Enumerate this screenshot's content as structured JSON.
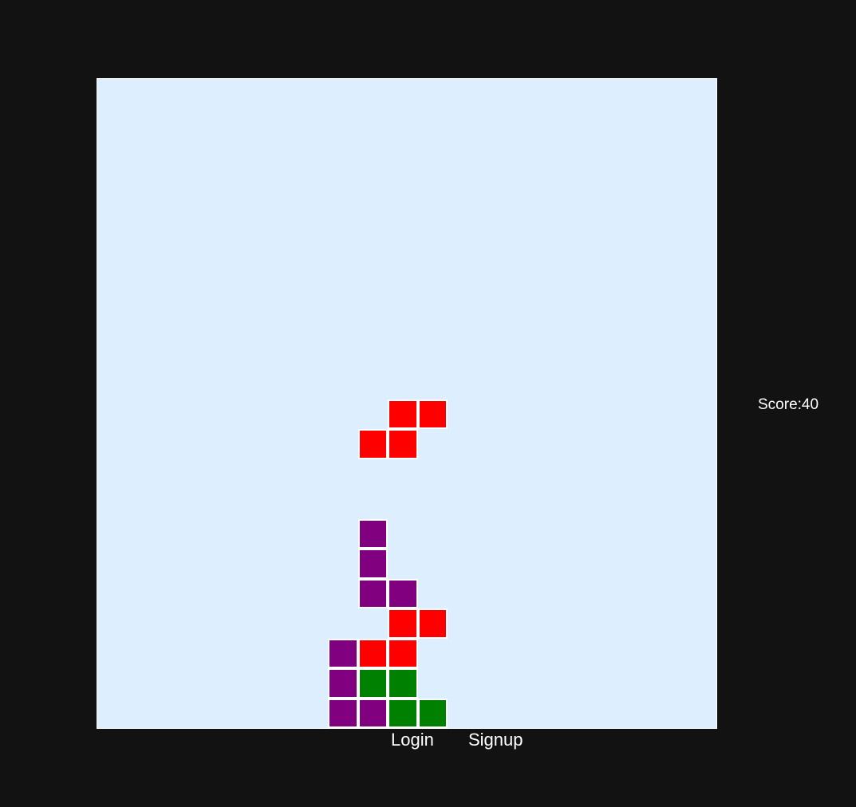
{
  "score": {
    "label": "Score:40"
  },
  "auth": {
    "login_label": "Login",
    "signup_label": "Signup"
  },
  "board": {
    "columns": 21,
    "rows": 22,
    "background": "#ddeeff",
    "cell_border_color": "#ffffff",
    "cells": [
      {
        "piece": "falling",
        "color": "#ff0000",
        "col": 10,
        "row": 11
      },
      {
        "piece": "falling",
        "color": "#ff0000",
        "col": 11,
        "row": 11
      },
      {
        "piece": "falling",
        "color": "#ff0000",
        "col": 9,
        "row": 12
      },
      {
        "piece": "falling",
        "color": "#ff0000",
        "col": 10,
        "row": 12
      },
      {
        "piece": "stacked",
        "color": "#800080",
        "col": 9,
        "row": 15
      },
      {
        "piece": "stacked",
        "color": "#800080",
        "col": 9,
        "row": 16
      },
      {
        "piece": "stacked",
        "color": "#800080",
        "col": 9,
        "row": 17
      },
      {
        "piece": "stacked",
        "color": "#800080",
        "col": 10,
        "row": 17
      },
      {
        "piece": "stacked",
        "color": "#ff0000",
        "col": 10,
        "row": 18
      },
      {
        "piece": "stacked",
        "color": "#ff0000",
        "col": 11,
        "row": 18
      },
      {
        "piece": "stacked",
        "color": "#800080",
        "col": 8,
        "row": 19
      },
      {
        "piece": "stacked",
        "color": "#ff0000",
        "col": 9,
        "row": 19
      },
      {
        "piece": "stacked",
        "color": "#ff0000",
        "col": 10,
        "row": 19
      },
      {
        "piece": "stacked",
        "color": "#800080",
        "col": 8,
        "row": 20
      },
      {
        "piece": "stacked",
        "color": "#008000",
        "col": 9,
        "row": 20
      },
      {
        "piece": "stacked",
        "color": "#008000",
        "col": 10,
        "row": 20
      },
      {
        "piece": "stacked",
        "color": "#800080",
        "col": 8,
        "row": 21
      },
      {
        "piece": "stacked",
        "color": "#800080",
        "col": 9,
        "row": 21
      },
      {
        "piece": "stacked",
        "color": "#008000",
        "col": 10,
        "row": 21
      },
      {
        "piece": "stacked",
        "color": "#008000",
        "col": 11,
        "row": 21
      }
    ]
  }
}
